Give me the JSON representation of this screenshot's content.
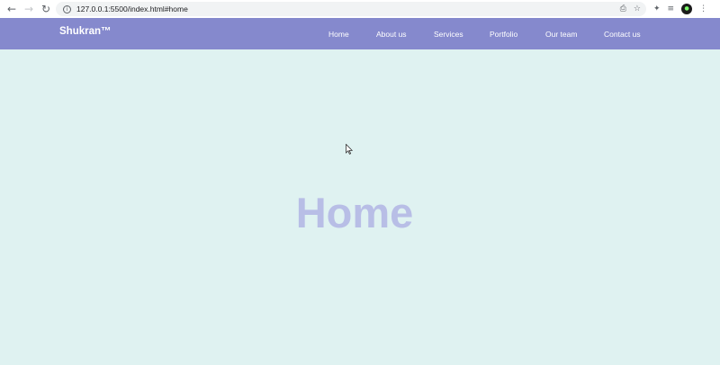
{
  "browser": {
    "url": "127.0.0.1:5500/index.html#home",
    "icons": {
      "back": "arrow-left-icon",
      "forward": "arrow-right-icon",
      "reload": "reload-icon",
      "site_info": "info-icon",
      "translate": "translate-icon",
      "bookmark": "star-icon",
      "extensions": "puzzle-icon",
      "reading_list": "reading-list-icon",
      "profile": "avatar",
      "menu": "kebab-menu-icon"
    }
  },
  "site": {
    "brand": "Shukran™",
    "nav_color": "#8589cd",
    "background_color": "#dff2f1",
    "menu": [
      {
        "label": "Home"
      },
      {
        "label": "About us"
      },
      {
        "label": "Services"
      },
      {
        "label": "Portfolio"
      },
      {
        "label": "Our team"
      },
      {
        "label": "Contact us"
      }
    ],
    "hero": {
      "title": "Home",
      "title_color": "#b8bee6"
    }
  }
}
